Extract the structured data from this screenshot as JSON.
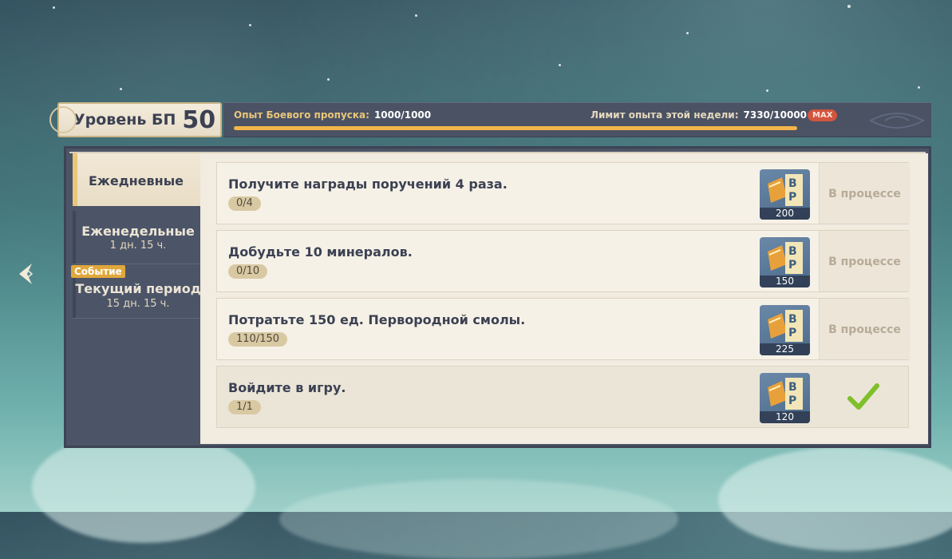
{
  "header": {
    "level_label": "Уровень БП",
    "level_value": "50",
    "xp_label": "Опыт Боевого пропуска:",
    "xp_value": "1000/1000",
    "xp_fraction": 1.0,
    "weekly_label": "Лимит опыта этой недели:",
    "weekly_value": "7330/10000",
    "max_badge": "MAX"
  },
  "tabs": {
    "daily": {
      "title": "Ежедневные"
    },
    "weekly": {
      "title": "Еженедельные",
      "time": "1 дн. 15 ч."
    },
    "period": {
      "badge": "Событие",
      "title": "Текущий период",
      "time": "15 дн. 15 ч."
    }
  },
  "tasks": [
    {
      "title": "Получите награды поручений 4 раза.",
      "progress": "0/4",
      "reward": "200",
      "status": "В процессе"
    },
    {
      "title": "Добудьте 10 минералов.",
      "progress": "0/10",
      "reward": "150",
      "status": "В процессе"
    },
    {
      "title": "Потратьте 150 ед. Первородной смолы.",
      "progress": "110/150",
      "reward": "225",
      "status": "В процессе"
    },
    {
      "title": "Войдите в игру.",
      "progress": "1/1",
      "reward": "120",
      "status": ""
    }
  ],
  "colors": {
    "accent_gold": "#f2b54a",
    "panel_dark": "#4c5468",
    "check_green": "#7fbf2a",
    "max_red": "#d1553f"
  },
  "icons": {
    "back": "back-arrow-icon",
    "reward": "bp-exp-icon",
    "done": "checkmark-icon"
  }
}
